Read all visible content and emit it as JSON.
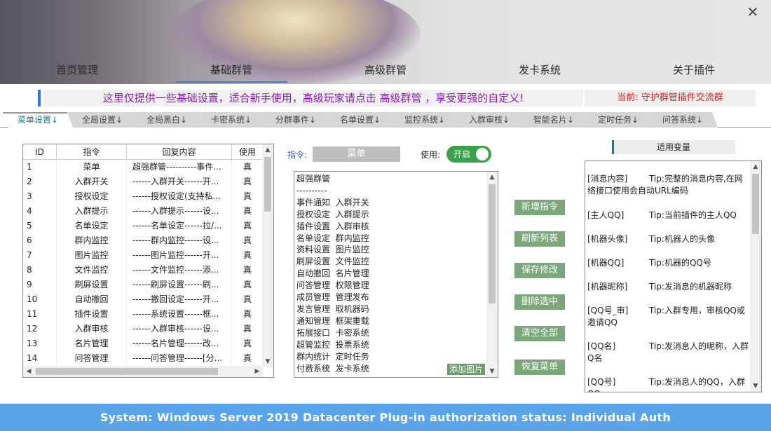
{
  "window": {
    "close_label": "✕"
  },
  "nav": [
    "首页管理",
    "基础群管",
    "高级群管",
    "发卡系统",
    "关于插件"
  ],
  "notice": {
    "text": "这里仅提供一些基础设置，适合新手使用，高级玩家请点击  高级群管  ，享受更强的自定义!",
    "group": "当前:  守护群管插件交流群"
  },
  "tabs": [
    "菜单设置↓",
    "全局设置↓",
    "全局黑白↓",
    "卡密系统↓",
    "分群事件↓",
    "名单设置↓",
    "监控系统↓",
    "入群审核↓",
    "智能名片↓",
    "定时任务↓",
    "问答系统↓"
  ],
  "table": {
    "headers": [
      "ID",
      "指令",
      "回复内容",
      "使用"
    ],
    "rows": [
      [
        "1",
        "菜单",
        "超强群管----------事件...",
        "真"
      ],
      [
        "2",
        "入群开关",
        "------入群开关------开...",
        "真"
      ],
      [
        "3",
        "授权设定",
        "------授权设定(支持私...",
        "真"
      ],
      [
        "4",
        "入群提示",
        "------入群提示------设...",
        "真"
      ],
      [
        "5",
        "名单设定",
        "------名单设定------拉/...",
        "真"
      ],
      [
        "6",
        "群内监控",
        "------群内监控------设...",
        "真"
      ],
      [
        "7",
        "图片监控",
        "------图片监控------开...",
        "真"
      ],
      [
        "8",
        "文件监控",
        "------文件监控------添...",
        "真"
      ],
      [
        "9",
        "刷屏设置",
        "------刷屏设置------刷...",
        "真"
      ],
      [
        "10",
        "自动撤回",
        "------撤回设定------开...",
        "真"
      ],
      [
        "11",
        "插件设置",
        "------系统设置------框...",
        "真"
      ],
      [
        "12",
        "入群审核",
        "------入群审核------设...",
        "真"
      ],
      [
        "13",
        "名片管理",
        "------名片管理------改...",
        "真"
      ],
      [
        "14",
        "问答管理",
        "------问答管理------[分...",
        "真"
      ]
    ]
  },
  "editor": {
    "cmd_label": "指令:",
    "cmd_value": "菜单",
    "use_label": "使用:",
    "toggle_label": "开启",
    "content": "超强群管\n----------\n事件通知  入群开关\n授权设定  入群提示\n插件设置  入群审核\n名单设定  群内监控\n资料设置  图片监控\n刷屏设置  文件监控\n自动撤回  名片管理\n问答管理  权限管理\n成员管理  管理发布\n发言管理  取机器码\n通知管理  框架重载\n拓展接口  卡密系统\n超管监控  投票系统\n群内统计  定时任务\n付费系统  发卡系统",
    "add_image": "添加图片"
  },
  "buttons": [
    "新增指令",
    "刷新列表",
    "保存修改",
    "删除选中",
    "清空全部",
    "恢复菜单"
  ],
  "vars": {
    "title": "适用变量",
    "items": [
      {
        "key": "[消息内容]",
        "tip": "Tip:完整的消息内容,在网络接口使用会自动URL编码"
      },
      {
        "key": "[主人QQ]",
        "tip": "Tip:当前插件的主人QQ"
      },
      {
        "key": "[机器头像]",
        "tip": "Tip:机器人的头像"
      },
      {
        "key": "[机器QQ]",
        "tip": "Tip:机器的QQ号"
      },
      {
        "key": "[机器昵称]",
        "tip": "Tip:发消息的机器昵称"
      },
      {
        "key": "[QQ号_审]",
        "tip": "Tip:入群专用，审核QQ或邀请QQ"
      },
      {
        "key": "[QQ名]",
        "tip": "Tip:发消息人的昵称，入群Q名"
      },
      {
        "key": "[QQ号]",
        "tip": "Tip:发消息人的QQ，入群QQ"
      }
    ]
  },
  "footer": "System:  Windows Server 2019 Datacenter  Plug-in authorization status:  Individual Auth",
  "colors": {
    "accent": "#5aa4ec",
    "green_button": "#7aa87a",
    "toggle_on": "#3aa04a",
    "notice_text": "#8a1ab8",
    "notice_group": "#e02020"
  }
}
